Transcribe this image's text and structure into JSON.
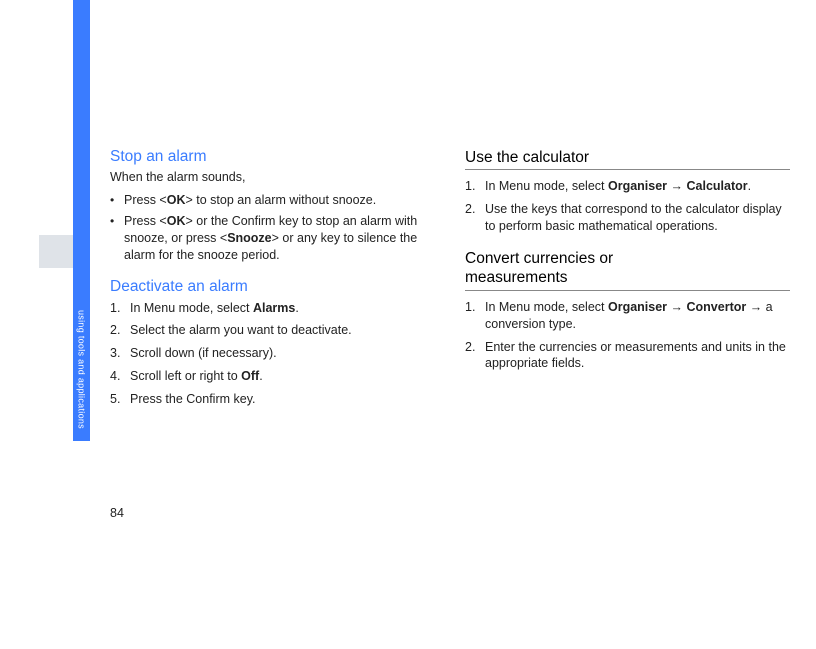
{
  "side_tab": "using tools and applications",
  "page_number": "84",
  "left": {
    "h1": "Stop an alarm",
    "intro": "When the alarm sounds,",
    "bullets": [
      {
        "pre": "Press <",
        "bold1": "OK",
        "mid1": "> to stop an alarm without snooze."
      },
      {
        "pre": "Press <",
        "bold1": "OK",
        "mid1": "> or the Confirm key to stop an alarm with snooze, or press <",
        "bold2": "Snooze",
        "post": "> or any key to silence the alarm for the snooze period."
      }
    ],
    "h2": "Deactivate an alarm",
    "steps": [
      {
        "pre": "In Menu mode, select ",
        "bold": "Alarms",
        "post": "."
      },
      {
        "text": "Select the alarm you want to deactivate."
      },
      {
        "text": "Scroll down (if necessary)."
      },
      {
        "pre": "Scroll left or right to ",
        "bold": "Off",
        "post": "."
      },
      {
        "text": "Press the Confirm key."
      }
    ]
  },
  "right": {
    "h1": "Use the calculator",
    "steps1": [
      {
        "pre": "In Menu mode, select ",
        "bold1": "Organiser",
        "arrow": " → ",
        "bold2": "Calculator",
        "post": "."
      },
      {
        "text": "Use the keys that correspond to the calculator display to perform basic mathematical operations."
      }
    ],
    "h2a": "Convert currencies or",
    "h2b": "measurements",
    "steps2": [
      {
        "pre": "In Menu mode, select ",
        "bold1": "Organiser",
        "arrow": " → ",
        "bold2": "Convertor",
        "post2": " → a conversion type."
      },
      {
        "text": "Enter the currencies or measurements and units in the appropriate fields."
      }
    ]
  }
}
